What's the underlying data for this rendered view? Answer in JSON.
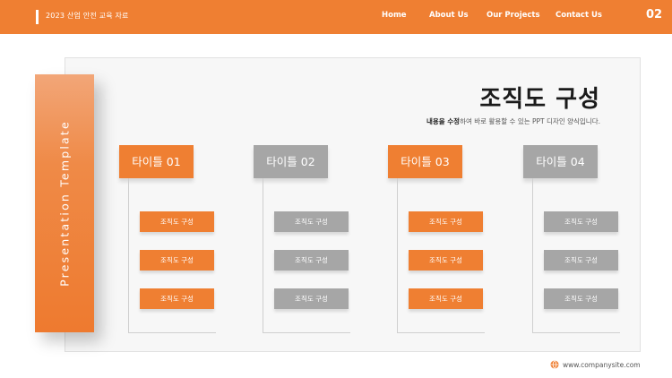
{
  "header": {
    "doc_title": "2023 산업 안전 교육 자료",
    "nav": [
      "Home",
      "About Us",
      "Our Projects",
      "Contact Us"
    ],
    "page_number": "02"
  },
  "side_bar": {
    "label": "Presentation Template"
  },
  "title": "조직도 구성",
  "subtitle": {
    "bold": "내용을 수정",
    "rest": "하여 바로 활용할 수 있는 PPT 디자인 양식입니다."
  },
  "columns": [
    {
      "title": "타이틀 01",
      "color": "orange",
      "items": [
        "조직도 구성",
        "조직도 구성",
        "조직도 구성"
      ]
    },
    {
      "title": "타이틀 02",
      "color": "gray",
      "items": [
        "조직도 구성",
        "조직도 구성",
        "조직도 구성"
      ]
    },
    {
      "title": "타이틀 03",
      "color": "orange",
      "items": [
        "조직도 구성",
        "조직도 구성",
        "조직도 구성"
      ]
    },
    {
      "title": "타이틀 04",
      "color": "gray",
      "items": [
        "조직도 구성",
        "조직도 구성",
        "조직도 구성"
      ]
    }
  ],
  "footer": {
    "url": "www.companysite.com",
    "icon": "globe-icon"
  },
  "colors": {
    "accent": "#EF7F32",
    "gray": "#A6A6A6"
  }
}
